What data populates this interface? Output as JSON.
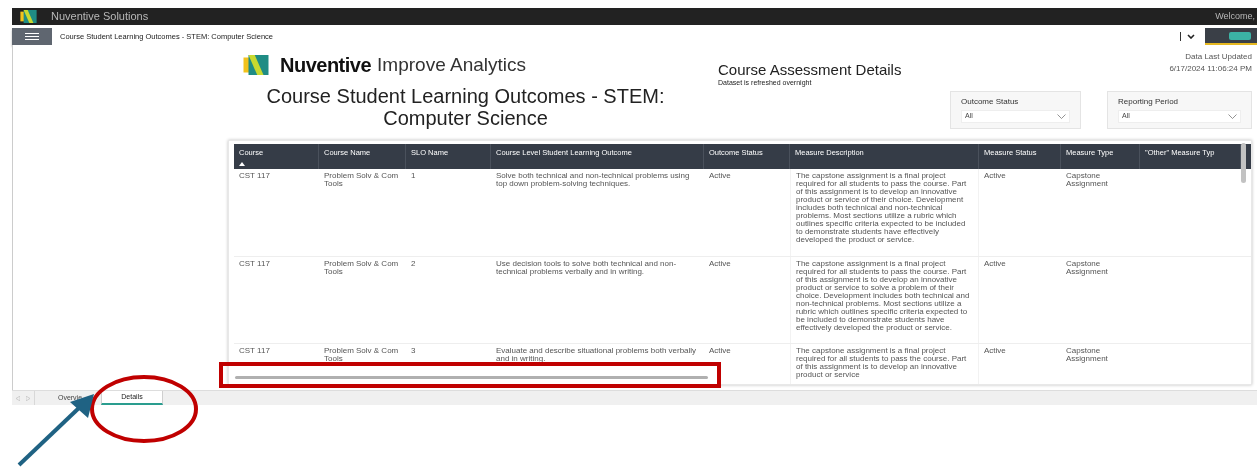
{
  "app_bar": {
    "title": "Nuventive Solutions",
    "welcome": "Welcome,"
  },
  "breadcrumb": "Course Student Learning Outcomes - STEM: Computer Science",
  "report": {
    "logo_brand": "Nuventive",
    "logo_product": "Improve Analytics",
    "section_title": "Course Assessment Details",
    "section_subtitle": "Dataset is refreshed overnight",
    "updated_label": "Data Last Updated",
    "updated_value": "6/17/2024 11:06:24 PM",
    "title_lines": [
      "Course Student Learning Outcomes - STEM:",
      "Computer Science"
    ]
  },
  "filters": [
    {
      "label": "Outcome Status",
      "value": "All"
    },
    {
      "label": "Reporting Period",
      "value": "All"
    }
  ],
  "table": {
    "columns": [
      {
        "label": "Course",
        "sorted": true
      },
      {
        "label": "Course Name",
        "sorted": false
      },
      {
        "label": "SLO Name",
        "sorted": false
      },
      {
        "label": "Course Level Student Learning Outcome",
        "sorted": false
      },
      {
        "label": "Outcome Status",
        "sorted": false
      },
      {
        "label": "Measure Description",
        "sorted": false
      },
      {
        "label": "Measure Status",
        "sorted": false
      },
      {
        "label": "Measure Type",
        "sorted": false
      },
      {
        "label": "\"Other\" Measure Typ",
        "sorted": false
      }
    ],
    "rows": [
      [
        "CST 117",
        "Problem Solv & Com Tools",
        "1",
        "Solve both technical and non-technical problems using top down problem-solving techniques.",
        "Active",
        "The capstone assignment is a final project required for all students to pass the course. Part of this assignment is to develop an innovative product or service of their choice. Development includes both technical and non-technical problems. Most sections utilize a rubric which outlines specific criteria expected to be included to demonstrate students have effectively developed the product or service.",
        "Active",
        "Capstone Assignment",
        ""
      ],
      [
        "CST 117",
        "Problem Solv & Com Tools",
        "2",
        "Use decision tools to solve both technical and non-technical problems verbally and in writing.",
        "Active",
        "The capstone assignment is a final project required for all students to pass the course. Part of this assignment is to develop an innovative product or service to solve a problem of their choice. Development includes both technical and non-technical problems. Most sections utilize a rubric which outlines specific criteria expected to be included to demonstrate students have effectively developed the product or service.",
        "Active",
        "Capstone Assignment",
        ""
      ],
      [
        "CST 117",
        "Problem Solv & Com Tools",
        "3",
        "Evaluate and describe situational problems both verbally and in writing.",
        "Active",
        "The capstone assignment is a final project required for all students to pass the course. Part of this assignment is to develop an innovative product or service",
        "Active",
        "Capstone Assignment",
        ""
      ]
    ]
  },
  "page_tabs": [
    {
      "label": "Overvie",
      "selected": false
    },
    {
      "label": "Details",
      "selected": true
    }
  ],
  "annotations": [
    {
      "kind": "rectangle"
    },
    {
      "kind": "ellipse"
    },
    {
      "kind": "arrow"
    }
  ]
}
